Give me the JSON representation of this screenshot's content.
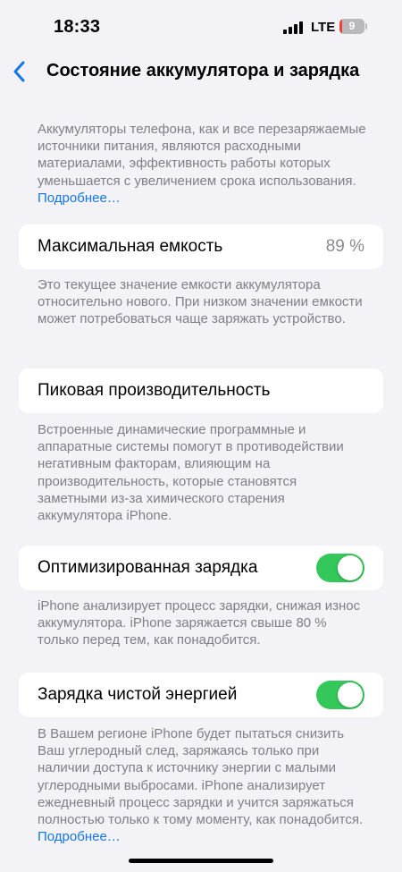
{
  "status_bar": {
    "time": "18:33",
    "network": "LTE",
    "battery_level": "9",
    "battery_fraction": 0.09,
    "battery_color": "#ea4335"
  },
  "nav": {
    "back_icon": "chevron-left-icon",
    "title": "Состояние аккумулятора и зарядка"
  },
  "intro": {
    "text": "Аккумуляторы телефона, как и все перезаряжаемые источники питания, являются расходными материалами, эффективность работы которых уменьшается с увеличением срока использования.",
    "link": "Подробнее…"
  },
  "max_capacity": {
    "label": "Максимальная емкость",
    "value": "89 %",
    "footnote": "Это текущее значение емкости аккумулятора относительно нового. При низком значении емкости может потребоваться чаще заряжать устройство."
  },
  "peak_performance": {
    "label": "Пиковая производительность",
    "footnote": "Встроенные динамические программные и аппаратные системы помогут в противодействии негативным факторам, влияющим на производительность, которые становятся заметными из-за химического старения аккумулятора iPhone."
  },
  "optimized_charging": {
    "label": "Оптимизированная зарядка",
    "enabled": true,
    "footnote": "iPhone анализирует процесс зарядки, снижая износ аккумулятора. iPhone заряжается свыше 80 % только перед тем, как понадобится."
  },
  "clean_energy": {
    "label": "Зарядка чистой энергией",
    "enabled": true,
    "footnote": "В Вашем регионе iPhone будет пытаться снизить Ваш углеродный след, заряжаясь только при наличии доступа к источнику энергии с малыми углеродными выбросами. iPhone анализирует ежедневный процесс зарядки и учится заряжаться полностью только к тому моменту, как понадобится.",
    "link": "Подробнее…"
  },
  "colors": {
    "accent": "#1677e0",
    "toggle_on": "#34c759",
    "background": "#f2f2f7"
  }
}
